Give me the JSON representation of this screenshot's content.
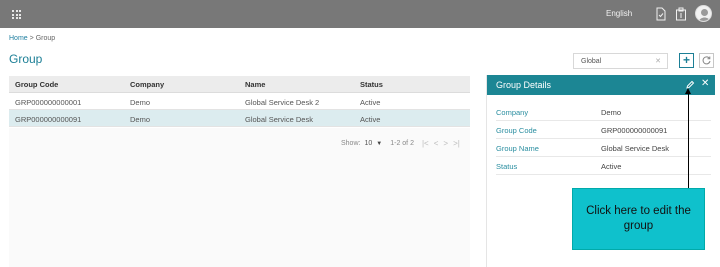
{
  "topbar": {
    "language": "English",
    "icons": [
      "apps-grid-icon",
      "document-icon",
      "clipboard-icon",
      "user-avatar"
    ]
  },
  "breadcrumb": {
    "home": "Home",
    "separator": ">",
    "current": "Group"
  },
  "page": {
    "title": "Group"
  },
  "search": {
    "value": "Global"
  },
  "grid": {
    "columns": [
      "Group Code",
      "Company",
      "Name",
      "Status"
    ],
    "rows": [
      [
        "GRP000000000001",
        "Demo",
        "Global Service Desk 2",
        "Active"
      ],
      [
        "GRP000000000091",
        "Demo",
        "Global Service Desk",
        "Active"
      ]
    ],
    "selected_row": 1
  },
  "pager": {
    "show_label": "Show:",
    "page_size": "10",
    "range": "1-2 of 2"
  },
  "details": {
    "title": "Group Details",
    "fields": [
      {
        "label": "Company",
        "value": "Demo"
      },
      {
        "label": "Group Code",
        "value": "GRP000000000091"
      },
      {
        "label": "Group Name",
        "value": "Global Service Desk"
      },
      {
        "label": "Status",
        "value": "Active"
      }
    ]
  },
  "callout": {
    "text": "Click here to edit the group"
  },
  "colors": {
    "accent": "#1c7f96",
    "header": "#1c8694",
    "topbar": "#787878",
    "callout": "#0fc1cc"
  }
}
